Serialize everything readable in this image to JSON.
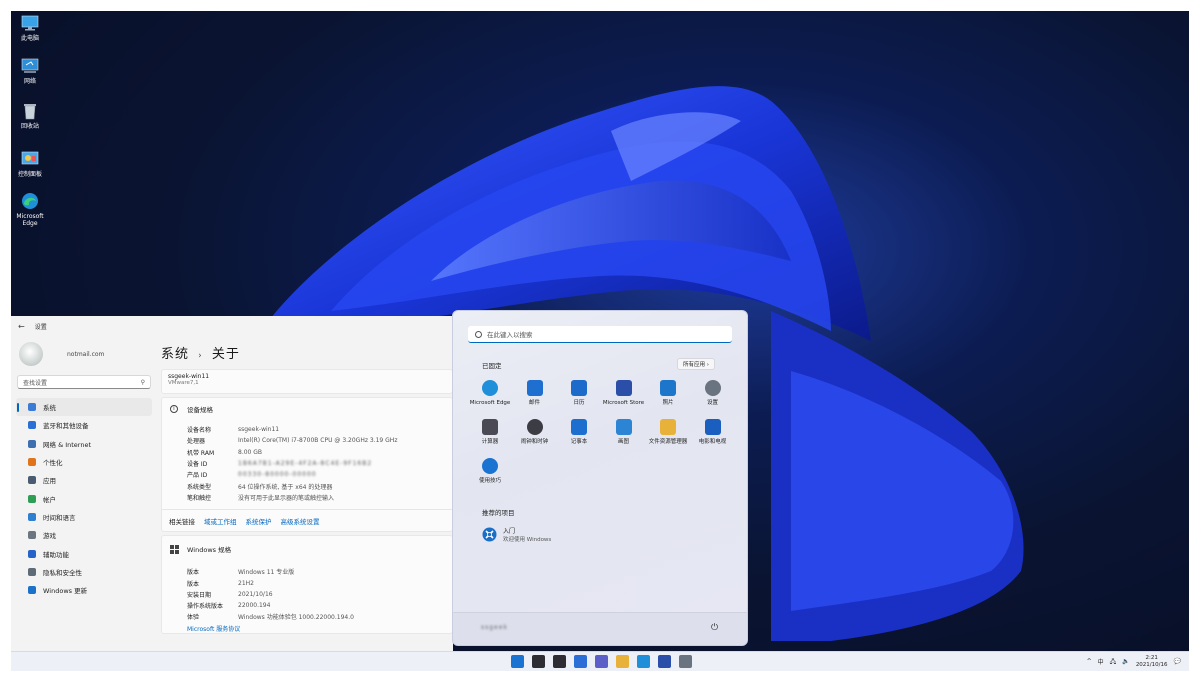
{
  "desktop": {
    "icons": [
      {
        "label": "此电脑",
        "icon": "computer-icon"
      },
      {
        "label": "网络",
        "icon": "network-icon"
      },
      {
        "label": "回收站",
        "icon": "recycle-bin-icon"
      },
      {
        "label": "控制面板",
        "icon": "control-panel-icon"
      },
      {
        "label": "Microsoft Edge",
        "icon": "edge-icon"
      }
    ]
  },
  "settings": {
    "title": "设置",
    "account_email": "notmail.com",
    "search_placeholder": "查找设置",
    "nav": [
      {
        "label": "系统",
        "color": "#3a7bd5",
        "selected": true
      },
      {
        "label": "蓝牙和其他设备",
        "color": "#2b6fd6"
      },
      {
        "label": "网络 & Internet",
        "color": "#3d6fb0"
      },
      {
        "label": "个性化",
        "color": "#e0741b"
      },
      {
        "label": "应用",
        "color": "#4a5b72"
      },
      {
        "label": "帐户",
        "color": "#2e9e57"
      },
      {
        "label": "时间和语言",
        "color": "#2f7fd0"
      },
      {
        "label": "游戏",
        "color": "#6b7680"
      },
      {
        "label": "辅助功能",
        "color": "#2563c8"
      },
      {
        "label": "隐私和安全性",
        "color": "#5d6b78"
      },
      {
        "label": "Windows 更新",
        "color": "#1a73c9"
      }
    ],
    "breadcrumb": {
      "parent": "系统",
      "separator": "›",
      "current": "关于"
    },
    "device_name": "ssgeek-win11",
    "device_model": "VMware7,1",
    "device_spec_title": "设备规格",
    "device_specs": [
      {
        "key": "设备名称",
        "value": "ssgeek-win11"
      },
      {
        "key": "处理器",
        "value": "Intel(R) Core(TM) i7-8700B CPU @ 3.20GHz   3.19 GHz"
      },
      {
        "key": "机带 RAM",
        "value": "8.00 GB"
      },
      {
        "key": "设备 ID",
        "value": "1B6A7B1-A29E-4F2A-8C4E-9F16B2"
      },
      {
        "key": "产品 ID",
        "value": "00330-80000-00000"
      },
      {
        "key": "系统类型",
        "value": "64 位操作系统, 基于 x64 的处理器"
      },
      {
        "key": "笔和触控",
        "value": "没有可用于此显示器的笔或触控输入"
      }
    ],
    "related_links": {
      "label": "相关链接",
      "items": [
        "域或工作组",
        "系统保护",
        "高级系统设置"
      ]
    },
    "windows_spec_title": "Windows 规格",
    "windows_specs": [
      {
        "key": "版本",
        "value": "Windows 11 专业版"
      },
      {
        "key": "版本",
        "value": "21H2"
      },
      {
        "key": "安装日期",
        "value": "2021/10/16"
      },
      {
        "key": "操作系统版本",
        "value": "22000.194"
      },
      {
        "key": "体验",
        "value": "Windows 功能体验包 1000.22000.194.0"
      }
    ],
    "service_agreement": "Microsoft 服务协议"
  },
  "start_menu": {
    "search_placeholder": "在此键入以搜索",
    "pinned_title": "已固定",
    "all_apps": "所有应用  ›",
    "pinned": [
      {
        "label": "Microsoft Edge",
        "icon": "edge-icon",
        "color": "#1e8fd8"
      },
      {
        "label": "邮件",
        "icon": "mail-icon",
        "color": "#1f6fd1"
      },
      {
        "label": "日历",
        "icon": "calendar-icon",
        "color": "#1c6ac9"
      },
      {
        "label": "Microsoft Store",
        "icon": "store-icon",
        "color": "#2b4ea8"
      },
      {
        "label": "照片",
        "icon": "photos-icon",
        "color": "#1d76c9"
      },
      {
        "label": "设置",
        "icon": "gear-icon",
        "color": "#6a7380"
      },
      {
        "label": "计算器",
        "icon": "calculator-icon",
        "color": "#4a4a55"
      },
      {
        "label": "闹钟和时钟",
        "icon": "clock-icon",
        "color": "#3c3c44"
      },
      {
        "label": "记事本",
        "icon": "notepad-icon",
        "color": "#1d6fcf"
      },
      {
        "label": "画图",
        "icon": "paint-icon",
        "color": "#2c84d4"
      },
      {
        "label": "文件资源管理器",
        "icon": "folder-icon",
        "color": "#e8b23a"
      },
      {
        "label": "电影和电视",
        "icon": "movies-icon",
        "color": "#1a5fbf"
      },
      {
        "label": "使用技巧",
        "icon": "tips-icon",
        "color": "#1a73d1"
      }
    ],
    "recommended_title": "推荐的项目",
    "recommended": [
      {
        "title": "入门",
        "subtitle": "欢迎使用 Windows",
        "icon": "get-started-icon"
      }
    ],
    "user_name": "ssgeek"
  },
  "taskbar": {
    "apps": [
      {
        "icon": "start-icon",
        "color": "#1a73d1"
      },
      {
        "icon": "search-icon",
        "color": "#2d2d33"
      },
      {
        "icon": "task-view-icon",
        "color": "#2d2d33"
      },
      {
        "icon": "widgets-icon",
        "color": "#2b6fd6"
      },
      {
        "icon": "chat-icon",
        "color": "#5b5fc7"
      },
      {
        "icon": "file-explorer-icon",
        "color": "#e8b23a"
      },
      {
        "icon": "edge-icon",
        "color": "#1e8fd8"
      },
      {
        "icon": "store-icon",
        "color": "#2b4ea8"
      },
      {
        "icon": "settings-icon",
        "color": "#6a7380"
      }
    ],
    "tray": {
      "chevron": "^",
      "ime": "中",
      "time": "2:21",
      "date": "2021/10/16"
    }
  }
}
